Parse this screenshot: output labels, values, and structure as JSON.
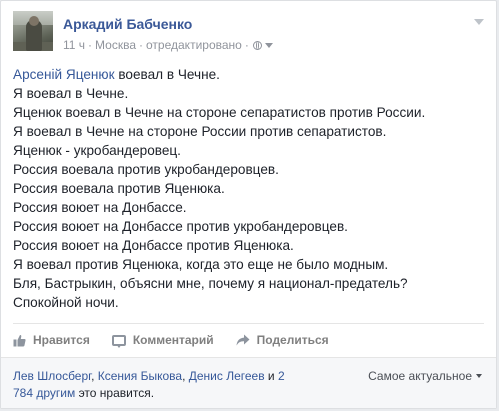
{
  "post": {
    "author": "Аркадий Бабченко",
    "time": "11 ч",
    "location": "Москва",
    "edited": "отредактировано",
    "separator": "·",
    "body": {
      "mention": "Арсеній Яценюк",
      "first_line_rest": " воевал в Чечне.",
      "lines": [
        "Я воевал в Чечне.",
        "Яценюк воевал в Чечне на стороне сепаратистов против России.",
        "Я воевал в Чечне на стороне России против сепаратистов.",
        "Яценюк - укробандеровец.",
        "Россия воевала против укробандеровцев.",
        "Россия воевала против Яценюка.",
        "Россия воюет на Донбассе.",
        "Россия воюет на Донбассе против укробандеровцев.",
        "Россия воюет на Донбассе против Яценюка.",
        "Я воевал против Яценюка, когда это еще не было модным.",
        "Бля, Бастрыкин, объясни мне, почему я национал-предатель?",
        "Спокойной ночи."
      ]
    }
  },
  "actions": {
    "like": "Нравится",
    "comment": "Комментарий",
    "share": "Поделиться"
  },
  "likes": {
    "name1": "Лев Шлосберг",
    "sep1": ", ",
    "name2": "Ксения Быкова",
    "sep2": ", ",
    "name3": "Денис Легеев",
    "and": " и ",
    "others": "2 784 другим",
    "suffix": " это нравится.",
    "sort_label": "Самое актуальное"
  },
  "icons": {
    "avatar": "author-avatar",
    "globe": "globe-icon",
    "like": "thumbs-up-icon",
    "comment": "comment-bubble-icon",
    "share": "share-arrow-icon"
  },
  "colors": {
    "link": "#365899",
    "author": "#3b5998",
    "text": "#1d2129",
    "meta": "#90949c",
    "action": "#7f7f7f"
  }
}
